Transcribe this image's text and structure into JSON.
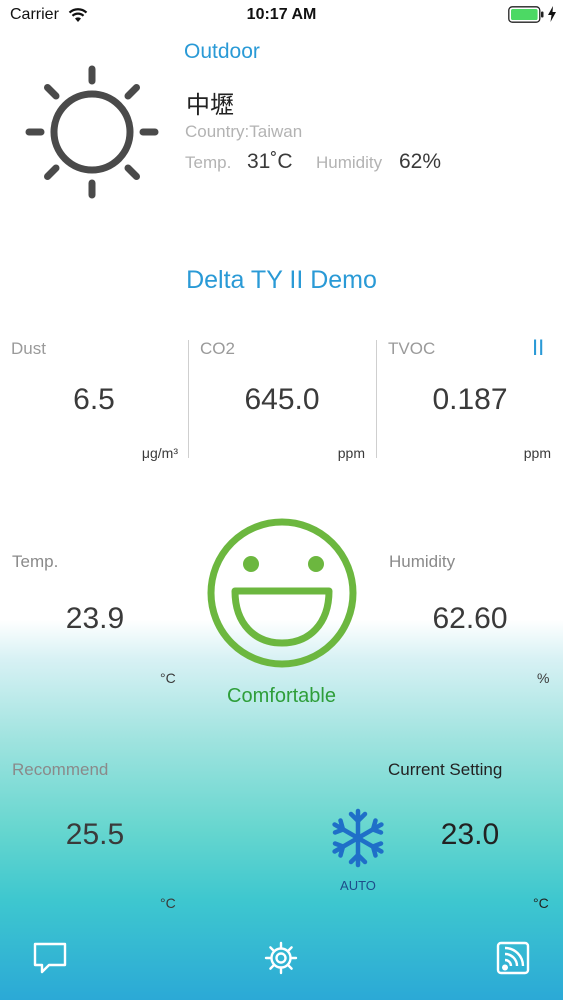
{
  "status_bar": {
    "carrier": "Carrier",
    "time": "10:17 AM",
    "battery_color": "#4cd964"
  },
  "outdoor": {
    "title": "Outdoor",
    "city": "中壢",
    "country": "Country:Taiwan",
    "temp_label": "Temp.",
    "temp_value": "31˚C",
    "humidity_label": "Humidity",
    "humidity_value": "62%",
    "icon": "sun-icon"
  },
  "device": {
    "name": "Delta TY II Demo",
    "pause_label": "II"
  },
  "sensors": [
    {
      "label": "Dust",
      "value": "6.5",
      "unit": "μg/m³"
    },
    {
      "label": "CO2",
      "value": "645.0",
      "unit": "ppm"
    },
    {
      "label": "TVOC",
      "value": "0.187",
      "unit": "ppm"
    }
  ],
  "indoor": {
    "temp_label": "Temp.",
    "temp_value": "23.9",
    "temp_unit": "°C",
    "humidity_label": "Humidity",
    "humidity_value": "62.60",
    "humidity_unit": "%",
    "comfort_label": "Comfortable",
    "comfort_color": "#6cb73f"
  },
  "recommend": {
    "label": "Recommend",
    "value": "25.5",
    "unit": "°C"
  },
  "current_setting": {
    "label": "Current Setting",
    "value": "23.0",
    "unit": "°C",
    "mode_icon": "snowflake-icon",
    "mode_label": "AUTO"
  },
  "nav": {
    "items": [
      "chat-icon",
      "gear-icon",
      "cast-icon"
    ]
  },
  "colors": {
    "accent": "#2a9ad6",
    "snow": "#1f6fc8"
  }
}
